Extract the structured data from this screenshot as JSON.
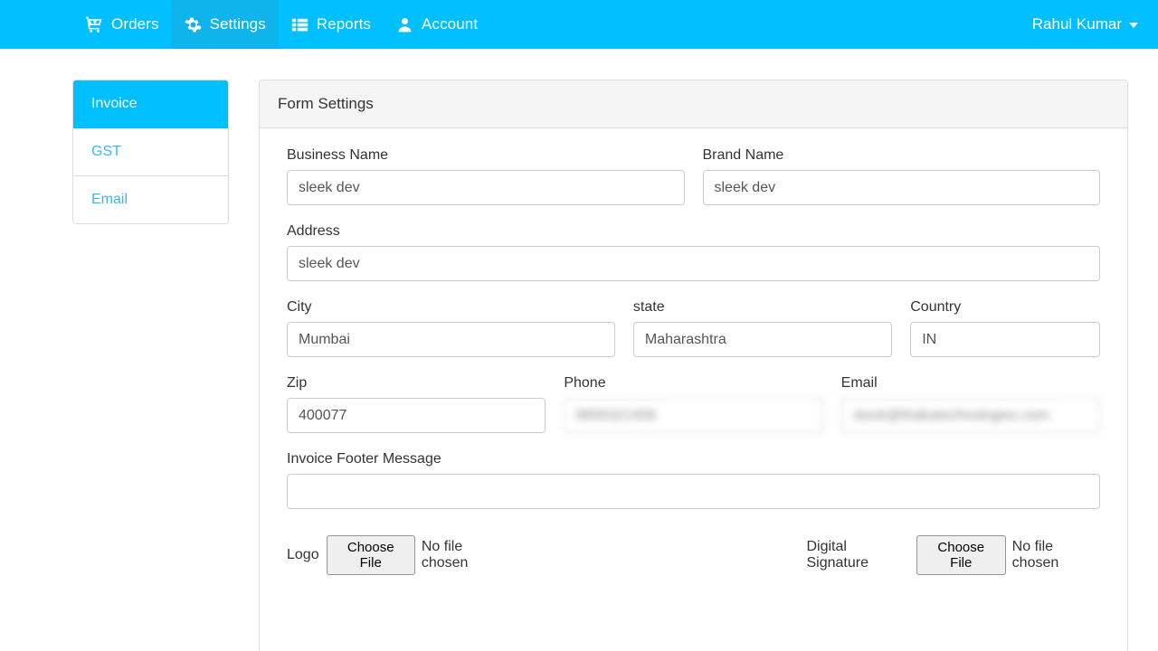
{
  "navbar": {
    "items": [
      {
        "label": "Orders",
        "icon": "shopping-cart-plus-icon",
        "active": false
      },
      {
        "label": "Settings",
        "icon": "gear-icon",
        "active": true
      },
      {
        "label": "Reports",
        "icon": "th-list-icon",
        "active": false
      },
      {
        "label": "Account",
        "icon": "user-icon",
        "active": false
      }
    ],
    "user": {
      "name": "Rahul Kumar",
      "caret_icon": "caret-down-icon"
    },
    "colors": {
      "background": "#00bfff",
      "active_background": "#0fb4ec",
      "text": "#ffffff"
    }
  },
  "sidebar": {
    "items": [
      {
        "label": "Invoice",
        "active": true
      },
      {
        "label": "GST",
        "active": false
      },
      {
        "label": "Email",
        "active": false
      }
    ],
    "colors": {
      "active_background": "#00bfff",
      "link": "#34b9f5"
    }
  },
  "panel": {
    "title": "Form Settings",
    "fields": {
      "business_name": {
        "label": "Business Name",
        "value": "sleek dev",
        "placeholder": "Business Name"
      },
      "brand_name": {
        "label": "Brand Name",
        "value": "sleek dev",
        "placeholder": "Brand Name"
      },
      "address": {
        "label": "Address",
        "value": "sleek dev",
        "placeholder": "Address"
      },
      "city": {
        "label": "City",
        "value": "Mumbai",
        "placeholder": "City"
      },
      "state": {
        "label": "state",
        "value": "Maharashtra",
        "placeholder": "state"
      },
      "country": {
        "label": "Country",
        "value": "IN",
        "placeholder": "Country"
      },
      "zip": {
        "label": "Zip",
        "value": "400077",
        "placeholder": "Zip"
      },
      "phone": {
        "label": "Phone",
        "value": "9856321456",
        "placeholder": "Phone",
        "redacted": true
      },
      "email": {
        "label": "Email",
        "value": "stock@thakatechnologies.com",
        "placeholder": "Email",
        "redacted": true
      },
      "invoice_footer": {
        "label": "Invoice Footer Message",
        "value": "",
        "placeholder": ""
      }
    },
    "uploads": [
      {
        "label": "Logo",
        "button": "Choose File",
        "status": "No file chosen"
      },
      {
        "label": "Digital Signature",
        "button": "Choose File",
        "status": "No file chosen"
      }
    ]
  }
}
